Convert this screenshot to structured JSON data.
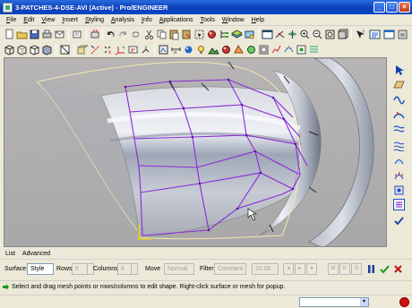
{
  "window": {
    "title": "3-PATCHES-4-DSE-AVI (Active) - Pro/ENGINEER",
    "buttons": {
      "minimize": "_",
      "maximize": "□",
      "close": "×"
    }
  },
  "menubar": {
    "items": [
      "File",
      "Edit",
      "View",
      "Insert",
      "Styling",
      "Analysis",
      "Info",
      "Applications",
      "Tools",
      "Window",
      "Help"
    ]
  },
  "toolbar": {
    "row1_icons": [
      "new-icon",
      "open-icon",
      "save-icon",
      "print-icon",
      "email-icon",
      "regen-icon",
      "undo-icon",
      "redo-icon",
      "cut-icon",
      "copy-icon",
      "paste-icon",
      "paste-special-icon",
      "regenerate-icon",
      "find-icon",
      "select-box-icon",
      "appearance-icon",
      "model-tree-icon",
      "layers-icon",
      "view-manager-icon",
      "repaint-icon",
      "spin-center-icon",
      "zoom-in-icon",
      "zoom-out-icon",
      "refit-icon",
      "orient-icon",
      "saved-views-icon",
      "context-help-icon"
    ],
    "row2_icons": [
      "wireframe-icon",
      "hidden-line-icon",
      "no-hidden-icon",
      "shading-icon",
      "datum-planes-icon",
      "datum-axes-icon",
      "datum-points-icon",
      "csys-icon",
      "annotations-icon"
    ]
  },
  "vertical_toolbar": {
    "icons": [
      "select-arrow-icon",
      "active-plane-icon",
      "curve-icon",
      "circle-icon",
      "curve-edit-icon",
      "surface-icon",
      "surface-edit-icon",
      "trim-icon",
      "curve-analysis-icon",
      "surface-analysis-icon",
      "dse-icon",
      "done-check-icon"
    ]
  },
  "dashboard": {
    "tabs": [
      "List",
      "Advanced"
    ],
    "surface_label": "Surface",
    "surface_value": "Style",
    "rows_label": "Rows",
    "rows_value": "5",
    "columns_label": "Columns",
    "columns_value": "6",
    "move_label": "Move",
    "move_value": "Normal",
    "filter_label": "Filter",
    "filter_value": "Constant",
    "step_value": "10.00",
    "buttons": {
      "m": "M",
      "k": "K",
      "o": "O"
    }
  },
  "message": {
    "text": "Select and drag mesh points or rows/columns to edit shape. Right-click surface or mesh for popup."
  },
  "colors": {
    "mesh": "#8a2ad8",
    "surface_edge": "#f2eab0",
    "titlebar": "#0a46c8",
    "confirm": "#1a9c1a",
    "cancel": "#c01010"
  }
}
